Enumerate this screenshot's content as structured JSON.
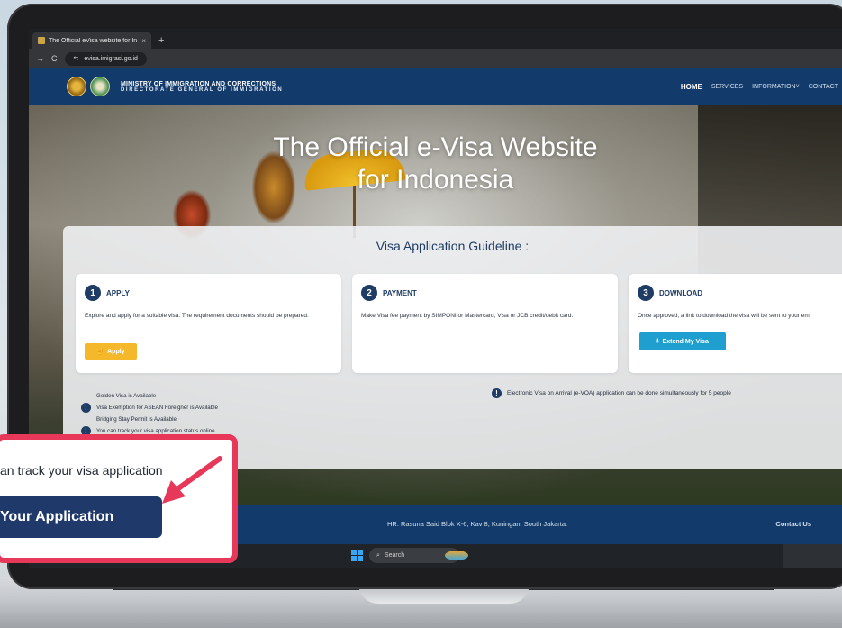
{
  "browser": {
    "tab_title": "The Official eVisa website for In",
    "tab_close": "×",
    "new_tab": "+",
    "nav_back": "→",
    "reload": "C",
    "site_info": "⇆",
    "url": "evisa.imigrasi.go.id"
  },
  "header": {
    "ministry_line1": "MINISTRY OF IMMIGRATION AND CORRECTIONS",
    "ministry_line2": "DIRECTORATE GENERAL OF IMMIGRATION",
    "nav": {
      "home": "HOME",
      "services": "SERVICES",
      "information": "INFORMATION",
      "information_chevron": "˅",
      "contact": "CONTACT"
    }
  },
  "hero": {
    "title_line1": "The Official e-Visa Website",
    "title_line2": "for Indonesia"
  },
  "guideline": {
    "title": "Visa Application Guideline :",
    "steps": [
      {
        "number": "1",
        "name": "APPLY",
        "description": "Explore and apply for a suitable visa. The requirement documents should be prepared.",
        "button": "Apply",
        "button_icon": "☝"
      },
      {
        "number": "2",
        "name": "PAYMENT",
        "description": "Make Visa fee payment by SIMPONI or Mastercard, Visa or JCB credit/debit card."
      },
      {
        "number": "3",
        "name": "DOWNLOAD",
        "description": "Once approved, a link to download the visa will be sent to your em",
        "button": "Extend My Visa",
        "button_icon": "⭳"
      }
    ],
    "notice_icon": "!",
    "notices": [
      "Golden Visa is Available",
      "Visa Exemption for ASEAN Foreigner is Available",
      "Bridging Stay Permit is Available",
      "You can track your visa application status online."
    ],
    "evoa_notice": "Electronic Visa on Arrival (e-VOA) application can be done simultaneously for 5 people"
  },
  "footer": {
    "address": "HR. Rasuna Said Blok X-6, Kav 8, Kuningan, South Jakarta.",
    "contact": "Contact Us"
  },
  "taskbar": {
    "search": "Search",
    "search_icon": "⌕"
  },
  "callout": {
    "text": "an track your visa application",
    "button": "Your Application"
  },
  "colors": {
    "navy": "#123a6b",
    "apply_yellow": "#f5b82b",
    "extend_blue": "#1e9fd0",
    "callout_border": "#e8385a"
  }
}
